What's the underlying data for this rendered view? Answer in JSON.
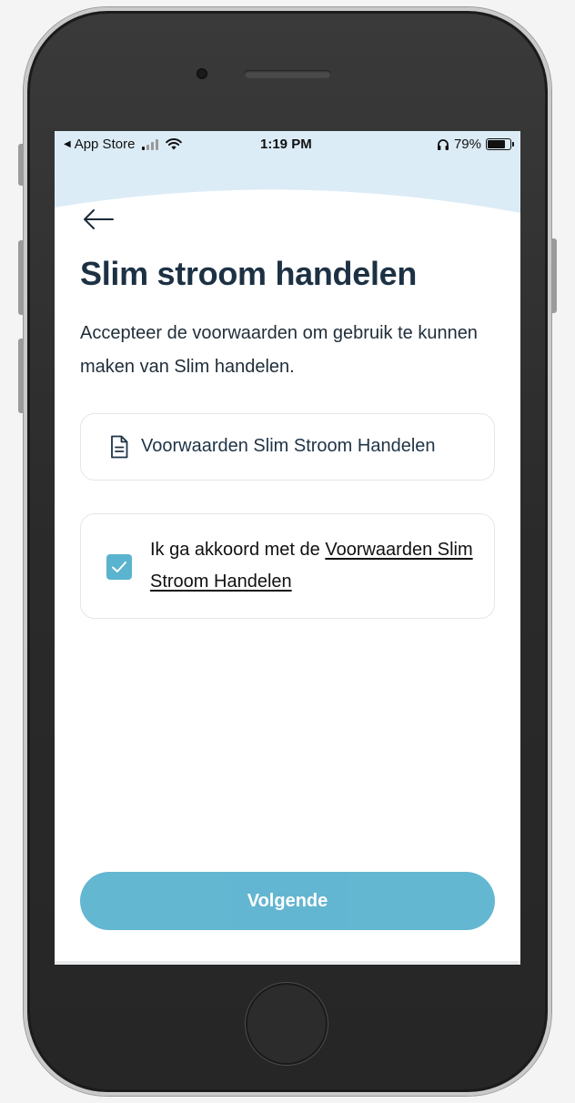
{
  "status_bar": {
    "carrier_back_label": "App Store",
    "time": "1:19 PM",
    "battery_percent": "79%",
    "battery_level": 0.79,
    "signal_bars_active": 1,
    "signal_bars_total": 4
  },
  "page": {
    "title": "Slim stroom handelen",
    "description": "Accepteer de voorwaarden om gebruik te kunnen maken van Slim handelen."
  },
  "document_link": {
    "label": "Voorwaarden Slim Stroom Handelen",
    "icon": "document-icon"
  },
  "agreement": {
    "prefix": "Ik ga akkoord met de",
    "link_text": "Voorwaarden Slim Stroom Handelen",
    "checked": true
  },
  "actions": {
    "next_label": "Volgende"
  },
  "colors": {
    "accent": "#5bb3cf",
    "title": "#1d3144",
    "header_background": "#dcecf6"
  }
}
